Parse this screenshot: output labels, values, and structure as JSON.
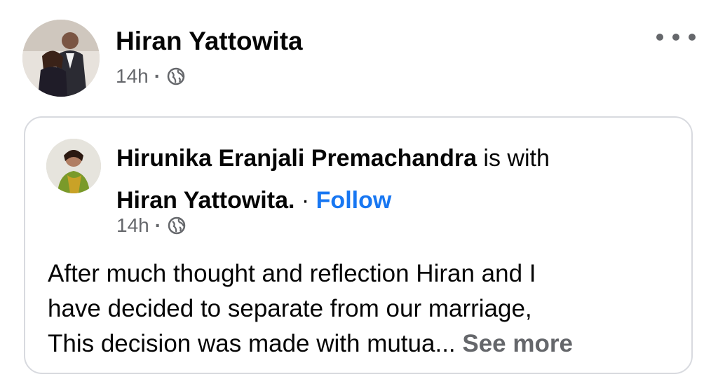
{
  "post": {
    "author": "Hiran Yattowita",
    "time": "14h",
    "separator": "·",
    "privacy_icon": "globe-icon",
    "more_icon": "more-horizontal-icon"
  },
  "shared_post": {
    "author": "Hirunika Eranjali Premachandra",
    "with_text": " is with",
    "tagged": "Hiran Yattowita.",
    "separator": " · ",
    "follow_label": "Follow",
    "time": "14h",
    "meta_separator": "·",
    "privacy_icon": "globe-icon",
    "text_lines": [
      "After much thought and reflection Hiran and I",
      "have decided to separate from our marriage,",
      "This decision was made with mutua... "
    ],
    "see_more_label": "See more"
  },
  "colors": {
    "text": "#050505",
    "secondary": "#65676b",
    "link": "#1877f2",
    "border": "#d8dadf"
  }
}
